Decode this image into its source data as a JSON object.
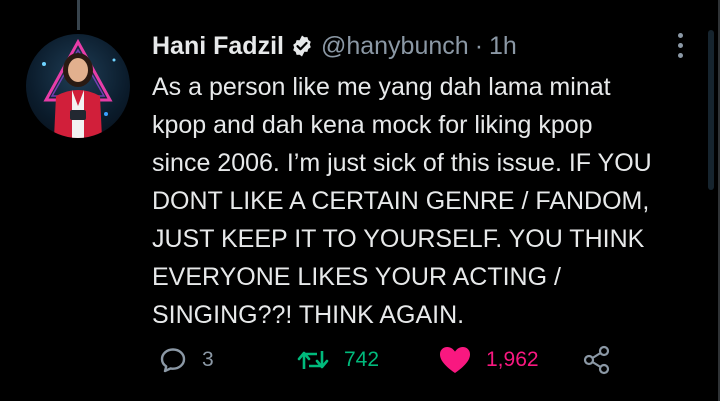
{
  "tweet": {
    "author_name": "Hani Fadzil",
    "handle": "@hanybunch",
    "separator": "·",
    "time": "1h",
    "lines": [
      "As a person like me yang dah lama minat",
      "kpop and dah kena mock for liking kpop",
      "since 2006. I’m just sick of this issue. IF YOU",
      "DONT LIKE A CERTAIN GENRE / FANDOM,",
      "JUST KEEP IT TO YOURSELF. YOU THINK",
      "EVERYONE LIKES YOUR ACTING /",
      "SINGING??! THINK AGAIN."
    ]
  },
  "actions": {
    "replies": "3",
    "retweets": "742",
    "likes": "1,962"
  },
  "icons": {
    "verified": "verified-badge-icon",
    "more": "more-options-icon",
    "reply": "reply-icon",
    "retweet": "retweet-icon",
    "like": "heart-icon",
    "share": "share-icon"
  },
  "colors": {
    "background": "#000000",
    "text": "#e7e9ea",
    "muted": "#8b98a5",
    "retweet": "#00ba7c",
    "like": "#f91880"
  }
}
